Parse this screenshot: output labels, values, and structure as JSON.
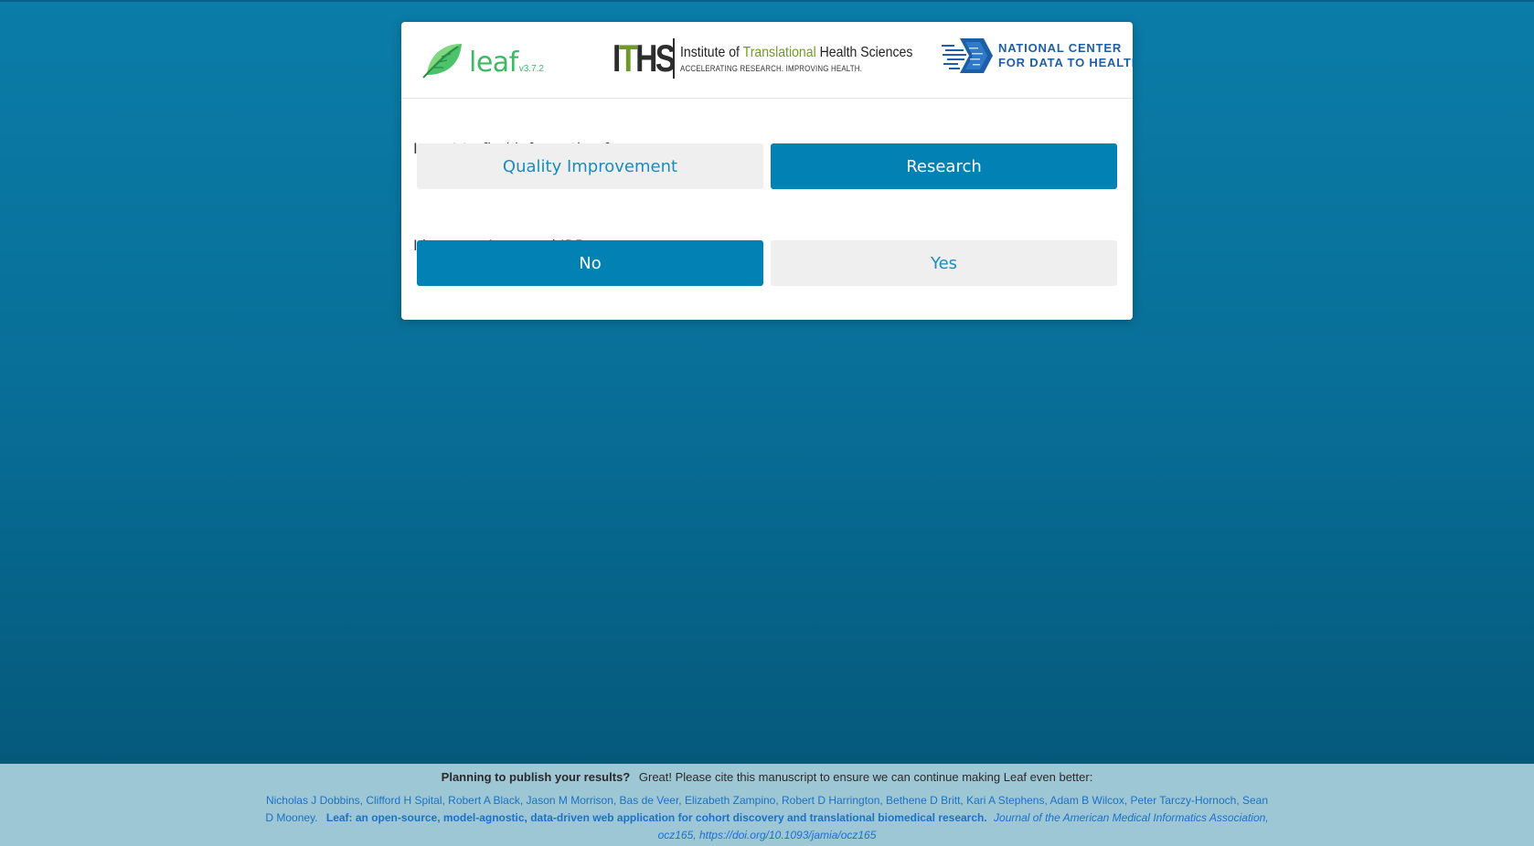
{
  "header": {
    "leaf_name": "leaf",
    "leaf_version": "v3.7.2",
    "iths": {
      "mark_pre": "I",
      "mark_t": "T",
      "mark_post": "HS",
      "name_pre": "Institute of ",
      "name_highlight": "Translational",
      "name_post": " Health Sciences",
      "tagline": "ACCELERATING RESEARCH. IMPROVING HEALTH."
    },
    "ncdh": {
      "line1": "NATIONAL CENTER",
      "line2": "FOR DATA TO HEALTH"
    }
  },
  "questions": [
    {
      "label": "I want to find information for",
      "options": [
        {
          "label": "Quality Improvement",
          "selected": false
        },
        {
          "label": "Research",
          "selected": true
        }
      ]
    },
    {
      "label": "I have an Approved IRB",
      "options": [
        {
          "label": "No",
          "selected": true
        },
        {
          "label": "Yes",
          "selected": false
        }
      ]
    }
  ],
  "footer": {
    "prompt_bold": "Planning to publish your results?",
    "prompt_text": "Great! Please cite this manuscript to ensure we can continue making Leaf even better:",
    "authors": "Nicholas J Dobbins, Clifford H Spital, Robert A Black, Jason M Morrison, Bas de Veer, Elizabeth Zampino, Robert D Harrington, Bethene D Britt, Kari A Stephens, Adam B Wilcox, Peter Tarczy-Hornoch, Sean D Mooney.",
    "title": "Leaf: an open-source, model-agnostic, data-driven web application for cohort discovery and translational biomedical research.",
    "journal": "Journal of the American Medical Informatics Association, ocz165, https://doi.org/10.1093/jamia/ocz165"
  },
  "colors": {
    "primary": "#0281b5",
    "option_off_bg": "#efefef",
    "option_off_text": "#1b8cbf",
    "leaf_green": "#3fb866",
    "iths_green": "#6f9a2a",
    "ncdh_blue": "#1c5fa8",
    "footer_bg": "#9ec7d6"
  }
}
